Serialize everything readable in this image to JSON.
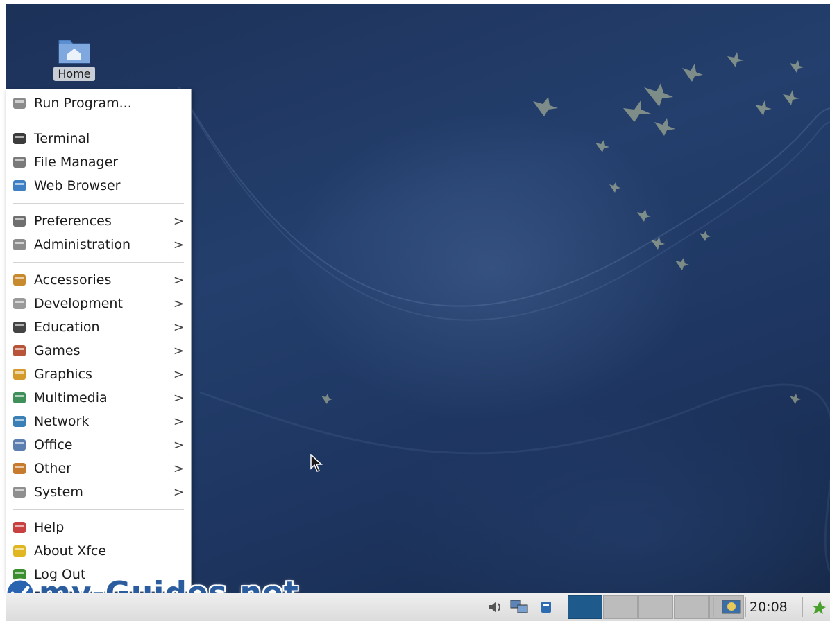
{
  "desktop": {
    "home_icon_label": "Home"
  },
  "app_menu": {
    "groups": [
      [
        {
          "label": "Run Program...",
          "icon": "run-icon",
          "submenu": false
        }
      ],
      [
        {
          "label": "Terminal",
          "icon": "terminal-icon",
          "submenu": false
        },
        {
          "label": "File Manager",
          "icon": "file-manager-icon",
          "submenu": false
        },
        {
          "label": "Web Browser",
          "icon": "web-browser-icon",
          "submenu": false
        }
      ],
      [
        {
          "label": "Preferences",
          "icon": "preferences-icon",
          "submenu": true
        },
        {
          "label": "Administration",
          "icon": "administration-icon",
          "submenu": true
        }
      ],
      [
        {
          "label": "Accessories",
          "icon": "accessories-icon",
          "submenu": true
        },
        {
          "label": "Development",
          "icon": "development-icon",
          "submenu": true
        },
        {
          "label": "Education",
          "icon": "education-icon",
          "submenu": true
        },
        {
          "label": "Games",
          "icon": "games-icon",
          "submenu": true
        },
        {
          "label": "Graphics",
          "icon": "graphics-icon",
          "submenu": true
        },
        {
          "label": "Multimedia",
          "icon": "multimedia-icon",
          "submenu": true
        },
        {
          "label": "Network",
          "icon": "network-icon",
          "submenu": true
        },
        {
          "label": "Office",
          "icon": "office-icon",
          "submenu": true
        },
        {
          "label": "Other",
          "icon": "other-icon",
          "submenu": true
        },
        {
          "label": "System",
          "icon": "system-icon",
          "submenu": true
        }
      ],
      [
        {
          "label": "Help",
          "icon": "help-icon",
          "submenu": false
        },
        {
          "label": "About Xfce",
          "icon": "about-icon",
          "submenu": false
        },
        {
          "label": "Log Out",
          "icon": "logout-icon",
          "submenu": false
        }
      ]
    ],
    "submenu_arrow": ">"
  },
  "taskbar": {
    "clock": "20:08",
    "workspaces": [
      {
        "active": true
      },
      {
        "active": false
      },
      {
        "active": false
      },
      {
        "active": false
      },
      {
        "active": false
      }
    ]
  },
  "watermark": {
    "text": "my-Guides.net"
  },
  "colors": {
    "desktop_bg": "#1f3763",
    "menu_bg": "#ffffff",
    "workspace_active": "#1e5b8c",
    "workspace_inactive": "#bcbcbc"
  }
}
